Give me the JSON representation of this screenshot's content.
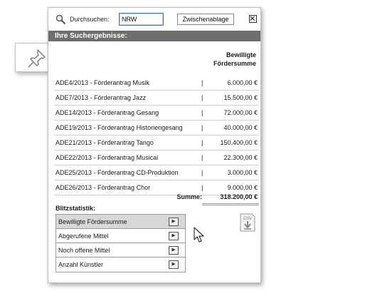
{
  "search": {
    "label": "Durchsuchen:",
    "value": "NRW",
    "clipboard_label": "Zwischenablage",
    "close_label": "×"
  },
  "results": {
    "header": "Ihre Suchergebnisse:",
    "column_header_line1": "Bewilligte",
    "column_header_line2": "Fördersumme",
    "rows": [
      {
        "code": "ADE4/2013   - Förderantrag Musik",
        "sep": "|",
        "amount": "6.000,00 €"
      },
      {
        "code": "ADE7/2013   - Förderantrag Jazz",
        "sep": "|",
        "amount": "15.500,00 €"
      },
      {
        "code": "ADE14/2013 - Förderantrag Gesang",
        "sep": "|",
        "amount": "72.000,00 €"
      },
      {
        "code": "ADE19/2013 - Förderantrag Historiengesang",
        "sep": "|",
        "amount": "40.000,00 €"
      },
      {
        "code": "ADE21/2013 - Förderantrag  Tango",
        "sep": "|",
        "amount": "150.400,00 €"
      },
      {
        "code": "ADE22/2013 - Förderantrag Musical",
        "sep": "|",
        "amount": "22.300,00 €"
      },
      {
        "code": "ADE25/2013 - Förderantrag CD-Produktion",
        "sep": "|",
        "amount": "3.000,00 €"
      },
      {
        "code": "ADE26/2013 - Förderantrag Chor",
        "sep": "|",
        "amount": "9.000,00 €"
      }
    ],
    "sum_label": "Summe:",
    "sum_value": "318.200,00 €"
  },
  "blitz": {
    "label": "Blitzstatistik:",
    "items": [
      {
        "label": "Bewilligte Fördersumme",
        "selected": true
      },
      {
        "label": "Abgerufene Mittel",
        "selected": false
      },
      {
        "label": "Noch offene Mittel",
        "selected": false
      },
      {
        "label": "Anzahl Künstler",
        "selected": false
      }
    ]
  },
  "export": {
    "csv_label": "CSV"
  },
  "icons": {
    "search": "search-icon",
    "pin": "pin-icon",
    "play": "play-icon",
    "csv": "csv-download-icon",
    "close": "close-icon",
    "cursor": "mouse-cursor-icon"
  },
  "colors": {
    "header_bg": "#6e6e6e",
    "input_border": "#3a78c9",
    "selected_item_bg": "#d8d8d8"
  }
}
